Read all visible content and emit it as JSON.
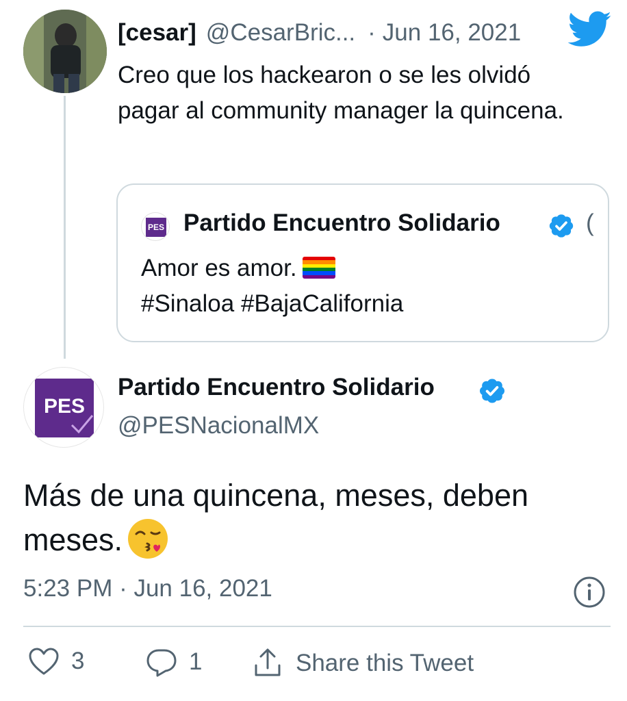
{
  "reply_tweet": {
    "display_name": "[cesar]",
    "handle": "@CesarBric...",
    "separator": "·",
    "date": "Jun 16, 2021",
    "text": "Creo que los hackearon o se les olvidó pagar al community manager la quincena."
  },
  "quoted_tweet": {
    "avatar_text": "PES",
    "display_name": "Partido Encuentro Solidario",
    "overflow": "(",
    "line1": "Amor es amor.",
    "line2": "#Sinaloa #BajaCalifornia"
  },
  "main_tweet": {
    "avatar_text": "PES",
    "display_name": "Partido Encuentro Solidario",
    "handle": "@PESNacionalMX",
    "text": "Más de una quincena, meses, deben meses.",
    "timestamp": "5:23 PM · Jun 16, 2021"
  },
  "actions": {
    "like_count": "3",
    "reply_count": "1",
    "share_label": "Share this Tweet"
  },
  "colors": {
    "twitter_blue": "#1d9bf0",
    "pes_purple": "#5e2b8c",
    "muted_text": "#536471",
    "border": "#cfd9de"
  },
  "icons": [
    "twitter-bird-icon",
    "verified-badge-icon",
    "rainbow-flag-emoji",
    "kissing-face-emoji",
    "info-icon",
    "heart-icon",
    "reply-bubble-icon",
    "share-icon"
  ]
}
